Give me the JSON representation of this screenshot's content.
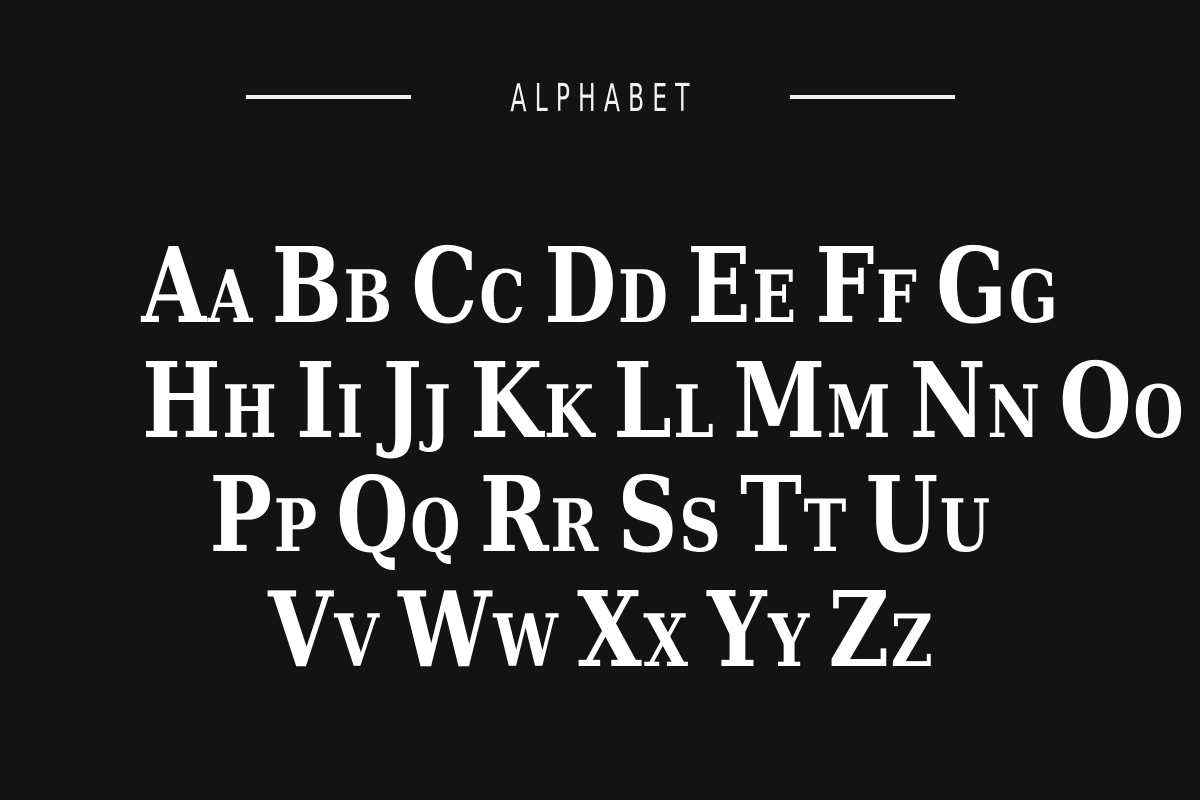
{
  "header": {
    "title": "ALPHABET"
  },
  "rows": [
    [
      {
        "upper": "A",
        "lower": "a"
      },
      {
        "upper": "B",
        "lower": "b"
      },
      {
        "upper": "C",
        "lower": "c"
      },
      {
        "upper": "D",
        "lower": "d"
      },
      {
        "upper": "E",
        "lower": "e"
      },
      {
        "upper": "F",
        "lower": "f"
      },
      {
        "upper": "G",
        "lower": "g"
      }
    ],
    [
      {
        "upper": "H",
        "lower": "h"
      },
      {
        "upper": "I",
        "lower": "i"
      },
      {
        "upper": "J",
        "lower": "j"
      },
      {
        "upper": "K",
        "lower": "k"
      },
      {
        "upper": "L",
        "lower": "l"
      },
      {
        "upper": "M",
        "lower": "m"
      },
      {
        "upper": "N",
        "lower": "n"
      },
      {
        "upper": "O",
        "lower": "o"
      }
    ],
    [
      {
        "upper": "P",
        "lower": "p"
      },
      {
        "upper": "Q",
        "lower": "q"
      },
      {
        "upper": "R",
        "lower": "r"
      },
      {
        "upper": "S",
        "lower": "s"
      },
      {
        "upper": "T",
        "lower": "t"
      },
      {
        "upper": "U",
        "lower": "u"
      }
    ],
    [
      {
        "upper": "V",
        "lower": "v"
      },
      {
        "upper": "W",
        "lower": "w"
      },
      {
        "upper": "X",
        "lower": "x"
      },
      {
        "upper": "Y",
        "lower": "y"
      },
      {
        "upper": "Z",
        "lower": "z"
      }
    ]
  ],
  "colors": {
    "background": "#131313",
    "foreground": "#ffffff"
  }
}
